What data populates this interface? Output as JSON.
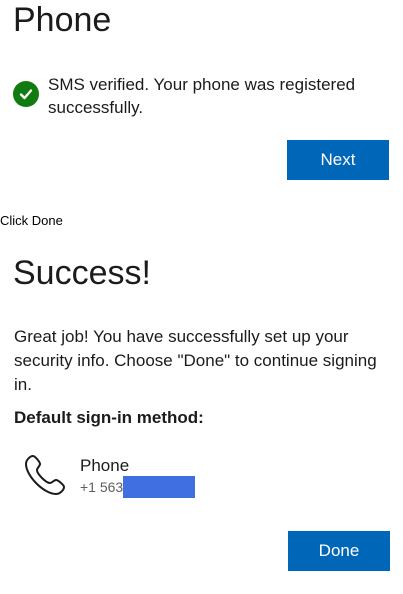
{
  "phone_step": {
    "title": "Phone",
    "status_text": "SMS verified. Your phone was registered successfully.",
    "next_label": "Next"
  },
  "instruction": "Click Done",
  "success_step": {
    "title": "Success!",
    "body": "Great job! You have successfully set up your security info. Choose \"Done\" to continue signing in.",
    "default_method_label": "Default sign-in method:",
    "method": {
      "name": "Phone",
      "number_prefix": "+1 563",
      "icon": "phone-icon"
    },
    "done_label": "Done"
  },
  "colors": {
    "primary": "#0067b8",
    "success": "#107c10",
    "redaction": "#3f6fe0"
  }
}
